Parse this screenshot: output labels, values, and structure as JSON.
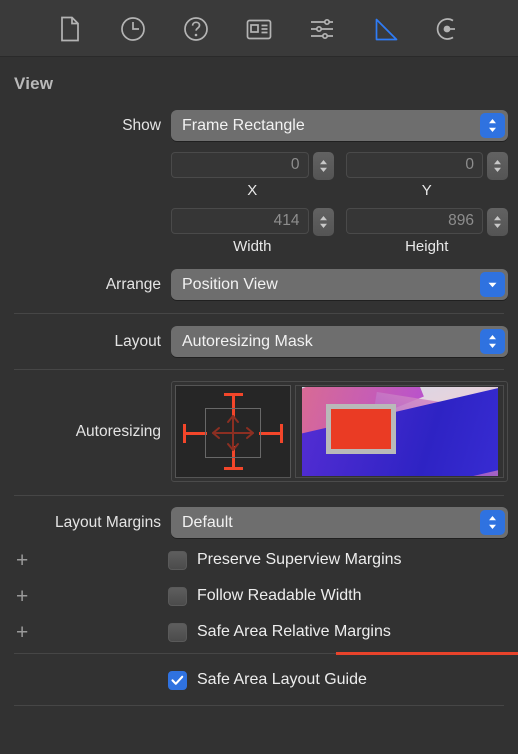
{
  "toolbar": {
    "items": [
      {
        "icon": "file-document-icon",
        "name": "file-inspector-tab",
        "active": false
      },
      {
        "icon": "clock-history-icon",
        "name": "history-inspector-tab",
        "active": false
      },
      {
        "icon": "question-circle-icon",
        "name": "help-inspector-tab",
        "active": false
      },
      {
        "icon": "identity-card-icon",
        "name": "identity-inspector-tab",
        "active": false
      },
      {
        "icon": "sliders-icon",
        "name": "attributes-inspector-tab",
        "active": false
      },
      {
        "icon": "ruler-triangle-icon",
        "name": "size-inspector-tab",
        "active": true
      },
      {
        "icon": "connections-circle-icon",
        "name": "connections-inspector-tab",
        "active": false
      }
    ]
  },
  "section": {
    "title": "View"
  },
  "show": {
    "label": "Show",
    "value": "Frame Rectangle"
  },
  "position": {
    "x": {
      "value": "0",
      "label": "X"
    },
    "y": {
      "value": "0",
      "label": "Y"
    },
    "width": {
      "value": "414",
      "label": "Width"
    },
    "height": {
      "value": "896",
      "label": "Height"
    }
  },
  "arrange": {
    "label": "Arrange",
    "value": "Position View"
  },
  "layout": {
    "label": "Layout",
    "value": "Autoresizing Mask"
  },
  "autoresizing": {
    "label": "Autoresizing"
  },
  "layout_margins": {
    "label": "Layout Margins",
    "value": "Default"
  },
  "checkboxes": [
    {
      "label": "Preserve Superview Margins",
      "checked": false,
      "plus": "+"
    },
    {
      "label": "Follow Readable Width",
      "checked": false,
      "plus": "+"
    },
    {
      "label": "Safe Area Relative Margins",
      "checked": false,
      "plus": "+"
    },
    {
      "label": "Safe Area Layout Guide",
      "checked": true,
      "plus": ""
    }
  ],
  "colors": {
    "accent_blue": "#2f72e0",
    "selected_icon": "#2f7cf6",
    "strut_red": "#f3462a",
    "error_line": "#e8432b",
    "panel_bg": "#323232",
    "toolbar_bg": "#3a3a3a",
    "popup_bg": "#6e6e6e",
    "preview_rect": "#ea3b24"
  }
}
